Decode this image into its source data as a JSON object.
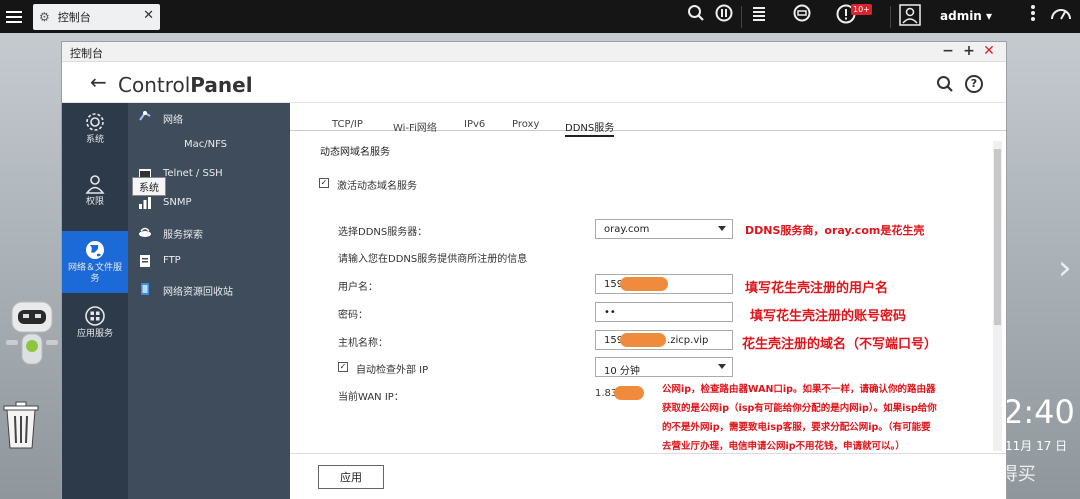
{
  "taskbar": {
    "tab_label": "控制台",
    "badge": "10+",
    "user": "admin ▾"
  },
  "window": {
    "title": "控制台",
    "header_prefix": "Control",
    "header_suffix": "Panel"
  },
  "nav1": [
    {
      "label": "系统",
      "icon": "gear-icon"
    },
    {
      "label": "权限",
      "icon": "user-icon"
    },
    {
      "label": "网络＆文件服务",
      "icon": "globe-icon",
      "active": true
    },
    {
      "label": "应用服务",
      "icon": "grid-icon"
    }
  ],
  "nav2": [
    {
      "label": "网络",
      "icon": "network-icon"
    },
    {
      "label": "Mac/NFS",
      "icon": "mac-nfs-icon"
    },
    {
      "label": "Telnet / SSH",
      "icon": "terminal-icon"
    },
    {
      "label": "SNMP",
      "icon": "bar-chart-icon"
    },
    {
      "label": "服务探索",
      "icon": "discovery-icon"
    },
    {
      "label": "FTP",
      "icon": "ftp-icon"
    },
    {
      "label": "网络资源回收站",
      "icon": "recycle-bin-icon"
    }
  ],
  "tooltip": "系统",
  "tabs": [
    "TCP/IP",
    "Wi-Fi网络",
    "IPv6",
    "Proxy",
    "DDNS服务"
  ],
  "form": {
    "section_title": "动态网域名服务",
    "enable_label": "激活动态域名服务",
    "enable_checked": true,
    "server_label": "选择DDNS服务器：",
    "server_value": "oray.com",
    "info_text": "请输入您在DDNS服务提供商所注册的信息",
    "username_label": "用户名：",
    "username_value": "159",
    "password_label": "密码：",
    "password_value": "••",
    "hostname_label": "主机名称：",
    "hostname_prefix": "159",
    "hostname_suffix": ".zicp.vip",
    "auto_check_label": "自动检查外部 IP",
    "auto_check_checked": true,
    "interval_value": "10 分钟",
    "wan_label": "当前WAN IP：",
    "wan_value": "1.83",
    "apply": "应用"
  },
  "annotations": {
    "server": "DDNS服务商，oray.com是花生壳",
    "username": "填写花生壳注册的用户名",
    "password": "填写花生壳注册的账号密码",
    "hostname": "花生壳注册的域名（不写端口号）",
    "wan_lines": [
      "公网ip，检查路由器WAN口ip。如果不一样，请确认你的路由器",
      "获取的是公网ip（isp有可能给你分配的是内网ip）。如果isp给你",
      "的不是外网ip，需要致电isp客服，要求分配公网ip。（有可能要",
      "去营业厅办理，电信申请公网ip不用花钱，申请就可以。）"
    ]
  },
  "desktop": {
    "clock": "2:40",
    "date": "11月 17 日",
    "watermark": "值 什么值得买"
  },
  "colors": {
    "accent": "#1b6ad8",
    "nav_dark": "#2d3a4a",
    "nav_mid": "#3e4c5b",
    "annotation_red": "#e0141a",
    "redaction": "#f08a3c"
  }
}
